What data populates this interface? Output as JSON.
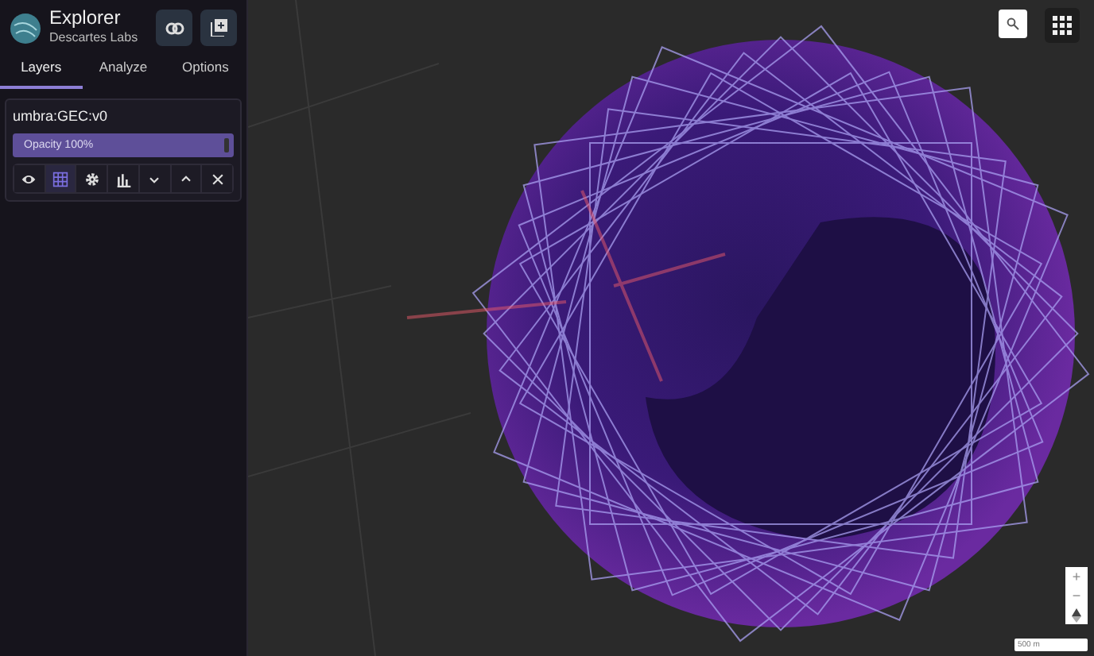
{
  "app": {
    "title": "Explorer",
    "subtitle": "Descartes Labs"
  },
  "tabs": [
    {
      "label": "Layers",
      "selected": true
    },
    {
      "label": "Analyze",
      "selected": false
    },
    {
      "label": "Options",
      "selected": false
    }
  ],
  "layer": {
    "name": "umbra:GEC:v0",
    "opacity_label": "Opacity 100%",
    "level": 1.0,
    "tools": [
      {
        "kind": "eye",
        "selected": false
      },
      {
        "kind": "grid",
        "selected": true
      },
      {
        "kind": "gear",
        "selected": false
      },
      {
        "kind": "chart",
        "selected": false
      },
      {
        "kind": "down",
        "selected": false
      },
      {
        "kind": "up",
        "selected": false
      },
      {
        "kind": "close",
        "selected": false
      }
    ]
  },
  "map": {
    "zoom_in": "+",
    "zoom_out": "−",
    "scale": "500 m"
  }
}
